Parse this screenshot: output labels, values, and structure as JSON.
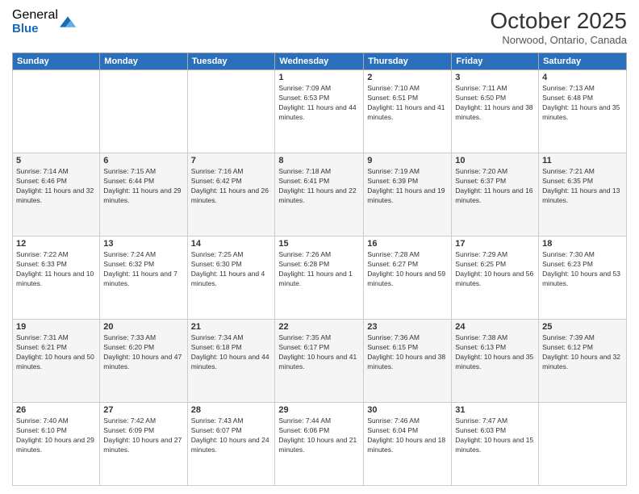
{
  "logo": {
    "general": "General",
    "blue": "Blue"
  },
  "header": {
    "month": "October 2025",
    "location": "Norwood, Ontario, Canada"
  },
  "weekdays": [
    "Sunday",
    "Monday",
    "Tuesday",
    "Wednesday",
    "Thursday",
    "Friday",
    "Saturday"
  ],
  "weeks": [
    [
      {
        "day": "",
        "sunrise": "",
        "sunset": "",
        "daylight": ""
      },
      {
        "day": "",
        "sunrise": "",
        "sunset": "",
        "daylight": ""
      },
      {
        "day": "",
        "sunrise": "",
        "sunset": "",
        "daylight": ""
      },
      {
        "day": "1",
        "sunrise": "Sunrise: 7:09 AM",
        "sunset": "Sunset: 6:53 PM",
        "daylight": "Daylight: 11 hours and 44 minutes."
      },
      {
        "day": "2",
        "sunrise": "Sunrise: 7:10 AM",
        "sunset": "Sunset: 6:51 PM",
        "daylight": "Daylight: 11 hours and 41 minutes."
      },
      {
        "day": "3",
        "sunrise": "Sunrise: 7:11 AM",
        "sunset": "Sunset: 6:50 PM",
        "daylight": "Daylight: 11 hours and 38 minutes."
      },
      {
        "day": "4",
        "sunrise": "Sunrise: 7:13 AM",
        "sunset": "Sunset: 6:48 PM",
        "daylight": "Daylight: 11 hours and 35 minutes."
      }
    ],
    [
      {
        "day": "5",
        "sunrise": "Sunrise: 7:14 AM",
        "sunset": "Sunset: 6:46 PM",
        "daylight": "Daylight: 11 hours and 32 minutes."
      },
      {
        "day": "6",
        "sunrise": "Sunrise: 7:15 AM",
        "sunset": "Sunset: 6:44 PM",
        "daylight": "Daylight: 11 hours and 29 minutes."
      },
      {
        "day": "7",
        "sunrise": "Sunrise: 7:16 AM",
        "sunset": "Sunset: 6:42 PM",
        "daylight": "Daylight: 11 hours and 26 minutes."
      },
      {
        "day": "8",
        "sunrise": "Sunrise: 7:18 AM",
        "sunset": "Sunset: 6:41 PM",
        "daylight": "Daylight: 11 hours and 22 minutes."
      },
      {
        "day": "9",
        "sunrise": "Sunrise: 7:19 AM",
        "sunset": "Sunset: 6:39 PM",
        "daylight": "Daylight: 11 hours and 19 minutes."
      },
      {
        "day": "10",
        "sunrise": "Sunrise: 7:20 AM",
        "sunset": "Sunset: 6:37 PM",
        "daylight": "Daylight: 11 hours and 16 minutes."
      },
      {
        "day": "11",
        "sunrise": "Sunrise: 7:21 AM",
        "sunset": "Sunset: 6:35 PM",
        "daylight": "Daylight: 11 hours and 13 minutes."
      }
    ],
    [
      {
        "day": "12",
        "sunrise": "Sunrise: 7:22 AM",
        "sunset": "Sunset: 6:33 PM",
        "daylight": "Daylight: 11 hours and 10 minutes."
      },
      {
        "day": "13",
        "sunrise": "Sunrise: 7:24 AM",
        "sunset": "Sunset: 6:32 PM",
        "daylight": "Daylight: 11 hours and 7 minutes."
      },
      {
        "day": "14",
        "sunrise": "Sunrise: 7:25 AM",
        "sunset": "Sunset: 6:30 PM",
        "daylight": "Daylight: 11 hours and 4 minutes."
      },
      {
        "day": "15",
        "sunrise": "Sunrise: 7:26 AM",
        "sunset": "Sunset: 6:28 PM",
        "daylight": "Daylight: 11 hours and 1 minute."
      },
      {
        "day": "16",
        "sunrise": "Sunrise: 7:28 AM",
        "sunset": "Sunset: 6:27 PM",
        "daylight": "Daylight: 10 hours and 59 minutes."
      },
      {
        "day": "17",
        "sunrise": "Sunrise: 7:29 AM",
        "sunset": "Sunset: 6:25 PM",
        "daylight": "Daylight: 10 hours and 56 minutes."
      },
      {
        "day": "18",
        "sunrise": "Sunrise: 7:30 AM",
        "sunset": "Sunset: 6:23 PM",
        "daylight": "Daylight: 10 hours and 53 minutes."
      }
    ],
    [
      {
        "day": "19",
        "sunrise": "Sunrise: 7:31 AM",
        "sunset": "Sunset: 6:21 PM",
        "daylight": "Daylight: 10 hours and 50 minutes."
      },
      {
        "day": "20",
        "sunrise": "Sunrise: 7:33 AM",
        "sunset": "Sunset: 6:20 PM",
        "daylight": "Daylight: 10 hours and 47 minutes."
      },
      {
        "day": "21",
        "sunrise": "Sunrise: 7:34 AM",
        "sunset": "Sunset: 6:18 PM",
        "daylight": "Daylight: 10 hours and 44 minutes."
      },
      {
        "day": "22",
        "sunrise": "Sunrise: 7:35 AM",
        "sunset": "Sunset: 6:17 PM",
        "daylight": "Daylight: 10 hours and 41 minutes."
      },
      {
        "day": "23",
        "sunrise": "Sunrise: 7:36 AM",
        "sunset": "Sunset: 6:15 PM",
        "daylight": "Daylight: 10 hours and 38 minutes."
      },
      {
        "day": "24",
        "sunrise": "Sunrise: 7:38 AM",
        "sunset": "Sunset: 6:13 PM",
        "daylight": "Daylight: 10 hours and 35 minutes."
      },
      {
        "day": "25",
        "sunrise": "Sunrise: 7:39 AM",
        "sunset": "Sunset: 6:12 PM",
        "daylight": "Daylight: 10 hours and 32 minutes."
      }
    ],
    [
      {
        "day": "26",
        "sunrise": "Sunrise: 7:40 AM",
        "sunset": "Sunset: 6:10 PM",
        "daylight": "Daylight: 10 hours and 29 minutes."
      },
      {
        "day": "27",
        "sunrise": "Sunrise: 7:42 AM",
        "sunset": "Sunset: 6:09 PM",
        "daylight": "Daylight: 10 hours and 27 minutes."
      },
      {
        "day": "28",
        "sunrise": "Sunrise: 7:43 AM",
        "sunset": "Sunset: 6:07 PM",
        "daylight": "Daylight: 10 hours and 24 minutes."
      },
      {
        "day": "29",
        "sunrise": "Sunrise: 7:44 AM",
        "sunset": "Sunset: 6:06 PM",
        "daylight": "Daylight: 10 hours and 21 minutes."
      },
      {
        "day": "30",
        "sunrise": "Sunrise: 7:46 AM",
        "sunset": "Sunset: 6:04 PM",
        "daylight": "Daylight: 10 hours and 18 minutes."
      },
      {
        "day": "31",
        "sunrise": "Sunrise: 7:47 AM",
        "sunset": "Sunset: 6:03 PM",
        "daylight": "Daylight: 10 hours and 15 minutes."
      },
      {
        "day": "",
        "sunrise": "",
        "sunset": "",
        "daylight": ""
      }
    ]
  ]
}
